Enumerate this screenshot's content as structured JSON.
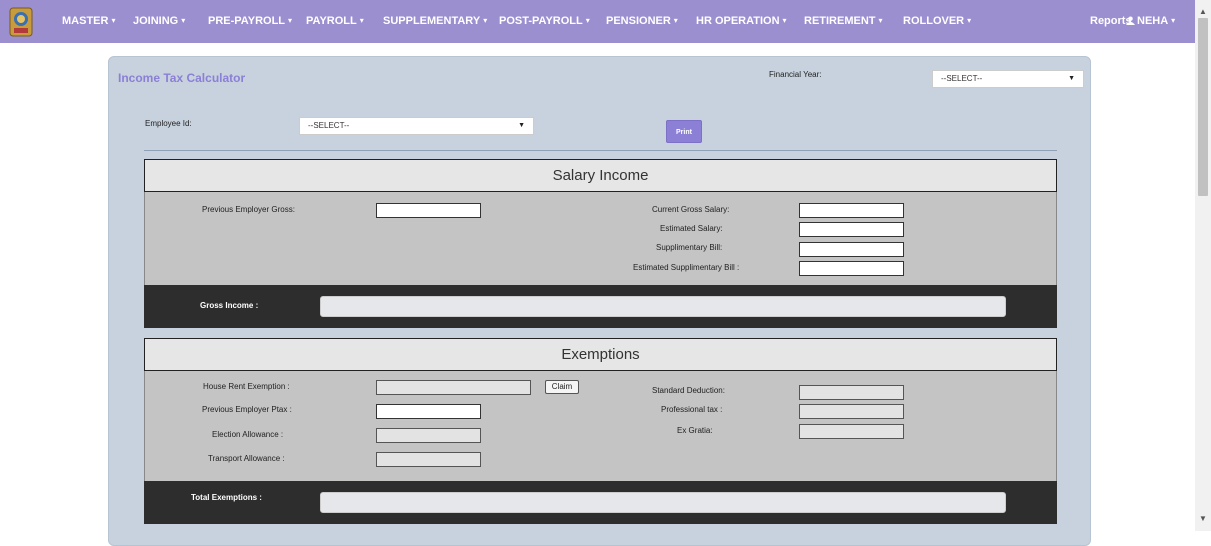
{
  "nav": {
    "items": [
      {
        "label": "MASTER",
        "caret": true
      },
      {
        "label": "JOINING",
        "caret": true
      },
      {
        "label": "PRE-PAYROLL",
        "caret": true
      },
      {
        "label": "PAYROLL",
        "caret": true
      },
      {
        "label": "SUPPLEMENTARY",
        "caret": true
      },
      {
        "label": "POST-PAYROLL",
        "caret": true
      },
      {
        "label": "PENSIONER",
        "caret": true
      },
      {
        "label": "HR OPERATION",
        "caret": true
      },
      {
        "label": "RETIREMENT",
        "caret": true
      },
      {
        "label": "ROLLOVER",
        "caret": true
      }
    ],
    "reports": "Reports",
    "user": "NEHA",
    "caret_symbol": "▾"
  },
  "page": {
    "title": "Income Tax Calculator",
    "financial_year_label": "Financial Year:",
    "financial_year_value": "--SELECT--",
    "employee_id_label": "Employee Id:",
    "employee_id_value": "--SELECT--",
    "print_label": "Print"
  },
  "salary": {
    "title": "Salary Income",
    "previous_employer_gross": "Previous Employer Gross:",
    "current_gross_salary": "Current Gross Salary:",
    "estimated_salary": "Estimated Salary:",
    "supplimentary_bill": "Supplimentary Bill:",
    "estimated_supplimentary_bill": "Estimated Supplimentary Bill :",
    "gross_income": "Gross Income :"
  },
  "exemptions": {
    "title": "Exemptions",
    "house_rent_exemption": "House Rent Exemption :",
    "claim_label": "Claim",
    "standard_deduction": "Standard Deduction:",
    "previous_employer_ptax": "Previous Employer Ptax :",
    "professional_tax": "Professional tax :",
    "election_allowance": "Election Allowance :",
    "ex_gratia": "Ex Gratia:",
    "transport_allowance": "Transport Allowance :",
    "total_exemptions": "Total Exemptions :"
  },
  "colors": {
    "navbar": "#9b8fcf",
    "accent": "#8b7fd6",
    "panel": "#c7d2de"
  }
}
